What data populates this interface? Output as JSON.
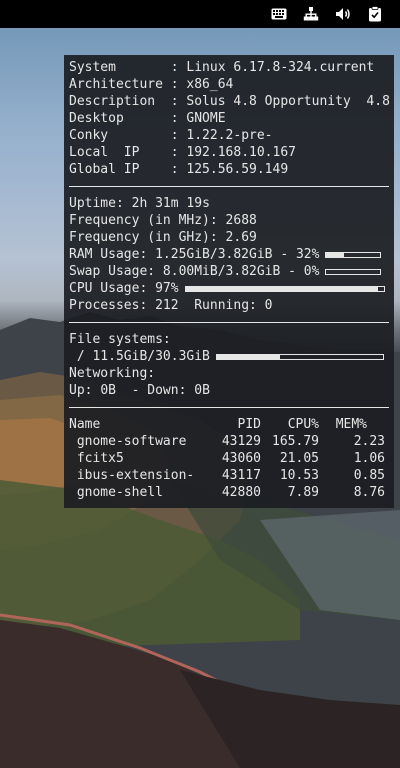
{
  "topbar": {
    "icons": [
      "keyboard-icon",
      "network-icon",
      "volume-icon",
      "clipboard-icon"
    ]
  },
  "system": [
    {
      "label": "System      ",
      "value": "Linux 6.17.8-324.current"
    },
    {
      "label": "Architecture",
      "value": "x86_64"
    },
    {
      "label": "Description ",
      "value": "Solus 4.8 Opportunity  4.8"
    },
    {
      "label": "Desktop     ",
      "value": "GNOME"
    },
    {
      "label": "Conky       ",
      "value": "1.22.2-pre-"
    },
    {
      "label": "Local  IP   ",
      "value": "192.168.10.167"
    },
    {
      "label": "Global IP   ",
      "value": "125.56.59.149"
    }
  ],
  "stats": {
    "uptime_label": "Uptime: ",
    "uptime": "2h 31m 19s",
    "freq_mhz_label": "Frequency (in MHz): ",
    "freq_mhz": "2688",
    "freq_ghz_label": "Frequency (in GHz): ",
    "freq_ghz": "2.69",
    "ram_label": "RAM Usage: ",
    "ram": "1.25GiB/3.82GiB - 32%",
    "ram_pct": 32,
    "swap_label": "Swap Usage: ",
    "swap": "8.00MiB/3.82GiB - 0%",
    "swap_pct": 0,
    "cpu_label": "CPU Usage: ",
    "cpu": "97%",
    "cpu_pct": 97,
    "processes_label": "Processes: ",
    "processes": "212",
    "running_label": "  Running: ",
    "running": "0"
  },
  "fs": {
    "title": "File systems:",
    "root": " / 11.5GiB/30.3GiB",
    "root_pct": 38,
    "networking_label": "Networking:",
    "up_label": "Up: ",
    "up": "0B",
    "down_label": "  - Down: ",
    "down": "0B"
  },
  "processes": {
    "headers": {
      "name": "Name",
      "pid": "PID",
      "cpu": "CPU%",
      "mem": "MEM%"
    },
    "rows": [
      {
        "name": " gnome-software",
        "pid": "43129",
        "cpu": "165.79",
        "mem": "2.23"
      },
      {
        "name": " fcitx5",
        "pid": "43060",
        "cpu": "21.05",
        "mem": "1.06"
      },
      {
        "name": " ibus-extension-",
        "pid": "43117",
        "cpu": "10.53",
        "mem": "0.85"
      },
      {
        "name": " gnome-shell",
        "pid": "42880",
        "cpu": "7.89",
        "mem": "8.76"
      }
    ]
  }
}
